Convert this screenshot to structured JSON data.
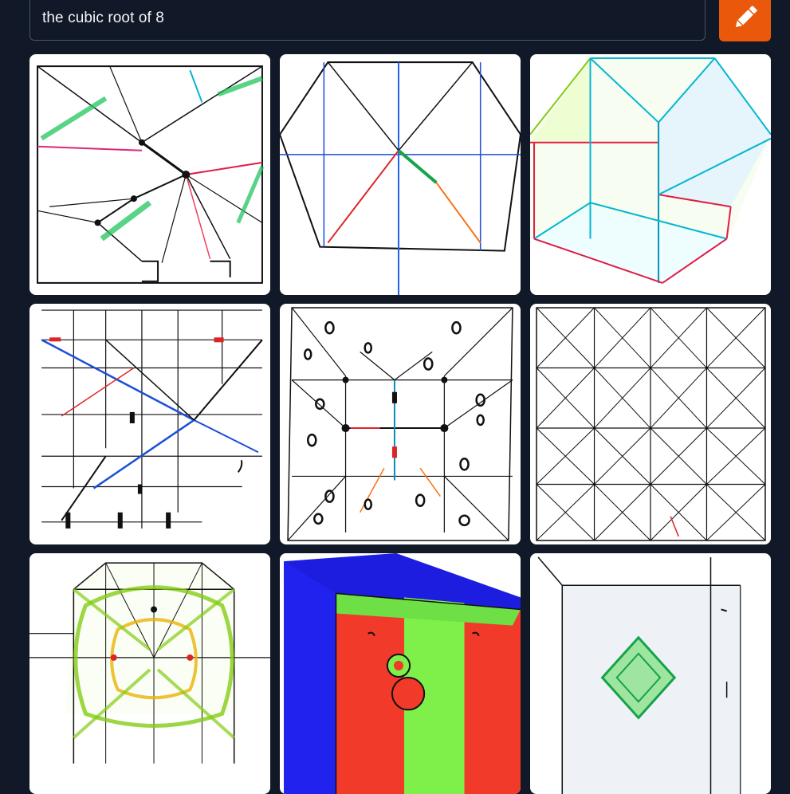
{
  "prompt": {
    "value": "the cubic root of 8"
  },
  "generate_button": {
    "icon": "pencil-icon",
    "color": "#ea580c"
  },
  "results": {
    "image_count": 9,
    "images": [
      {
        "name": "result-image-1"
      },
      {
        "name": "result-image-2"
      },
      {
        "name": "result-image-3"
      },
      {
        "name": "result-image-4"
      },
      {
        "name": "result-image-5"
      },
      {
        "name": "result-image-6"
      },
      {
        "name": "result-image-7"
      },
      {
        "name": "result-image-8"
      },
      {
        "name": "result-image-9"
      }
    ]
  },
  "colors": {
    "background": "#111827",
    "input_border": "#4b5563",
    "accent": "#ea580c",
    "text": "#f3f4f6"
  }
}
